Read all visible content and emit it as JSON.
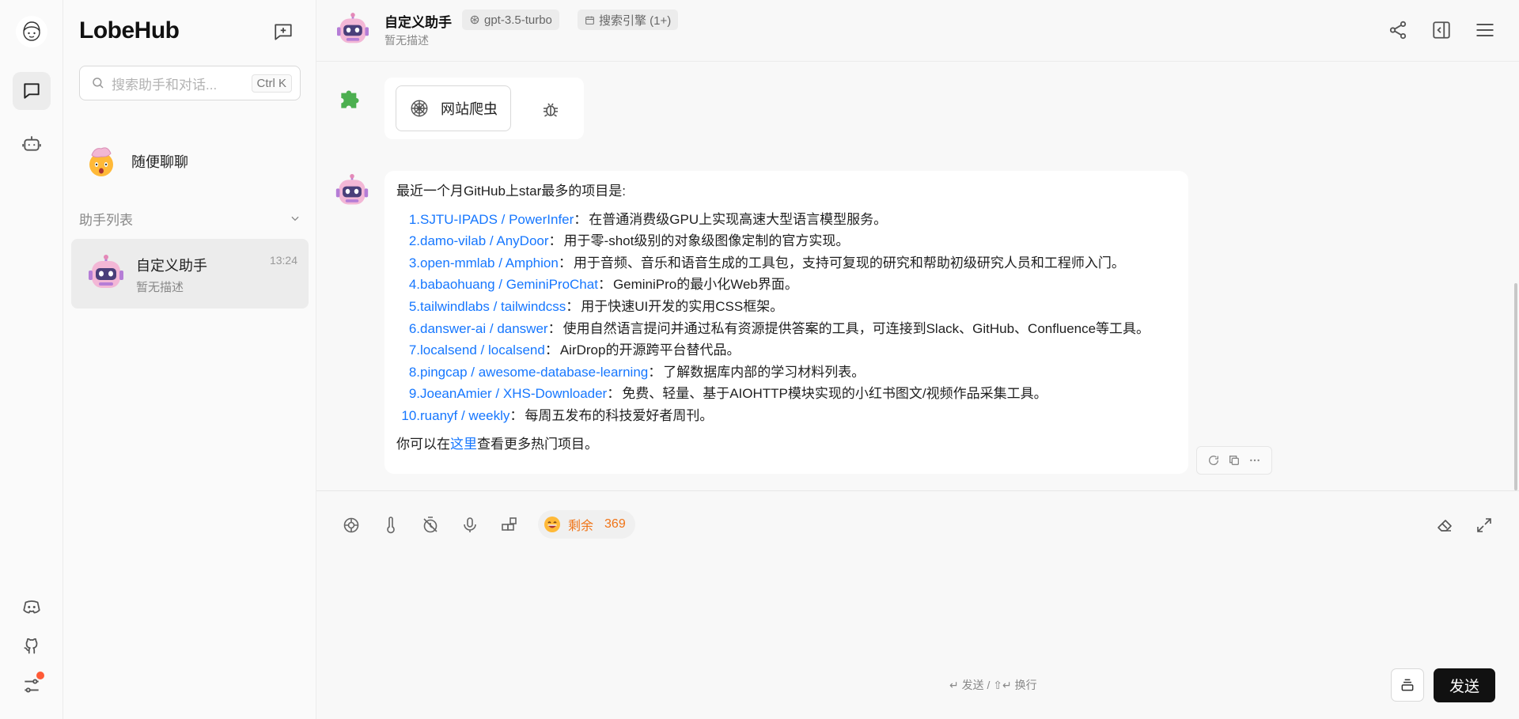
{
  "app": {
    "name": "LobeHub"
  },
  "sidebar": {
    "search_placeholder": "搜索助手和对话...",
    "search_shortcut": "Ctrl K",
    "inbox_label": "随便聊聊",
    "section_label": "助手列表",
    "sessions": [
      {
        "title": "自定义助手",
        "desc": "暂无描述",
        "time": "13:24"
      }
    ]
  },
  "header": {
    "title": "自定义助手",
    "desc": "暂无描述",
    "model_tag": "gpt-3.5-turbo",
    "plugin_tag": "搜索引擎 (1+)"
  },
  "plugin": {
    "tab_label": "网站爬虫"
  },
  "message": {
    "intro": "最近一个月GitHub上star最多的项目是:",
    "items": [
      {
        "num": "1.",
        "link": "SJTU-IPADS / PowerInfer",
        "text": "在普通消费级GPU上实现高速大型语言模型服务。"
      },
      {
        "num": "2.",
        "link": "damo-vilab / AnyDoor",
        "text": "用于零-shot级别的对象级图像定制的官方实现。"
      },
      {
        "num": "3.",
        "link": "open-mmlab / Amphion",
        "text": "用于音频、音乐和语音生成的工具包，支持可复现的研究和帮助初级研究人员和工程师入门。"
      },
      {
        "num": "4.",
        "link": "babaohuang / GeminiProChat",
        "text": "GeminiPro的最小化Web界面。"
      },
      {
        "num": "5.",
        "link": "tailwindlabs / tailwindcss",
        "text": "用于快速UI开发的实用CSS框架。"
      },
      {
        "num": "6.",
        "link": "danswer-ai / danswer",
        "text": "使用自然语言提问并通过私有资源提供答案的工具，可连接到Slack、GitHub、Confluence等工具。"
      },
      {
        "num": "7.",
        "link": "localsend / localsend",
        "text": "AirDrop的开源跨平台替代品。"
      },
      {
        "num": "8.",
        "link": "pingcap / awesome-database-learning",
        "text": "了解数据库内部的学习材料列表。"
      },
      {
        "num": "9.",
        "link": "JoeanAmier / XHS-Downloader",
        "text": "免费、轻量、基于AIOHTTP模块实现的小红书图文/视频作品采集工具。"
      },
      {
        "num": "10.",
        "link": "ruanyf / weekly",
        "text": "每周五发布的科技爱好者周刊。"
      }
    ],
    "outro_prefix": "你可以在",
    "outro_link": "这里",
    "outro_suffix": "查看更多热门项目。"
  },
  "input": {
    "tokens_label": "剩余",
    "tokens_count": "369",
    "send_hint": "↵ 发送 / ⇧↵ 换行",
    "send_label": "发送"
  },
  "colors": {
    "link": "#1677ff",
    "accent": "#f07316",
    "send_bg": "#111111"
  }
}
